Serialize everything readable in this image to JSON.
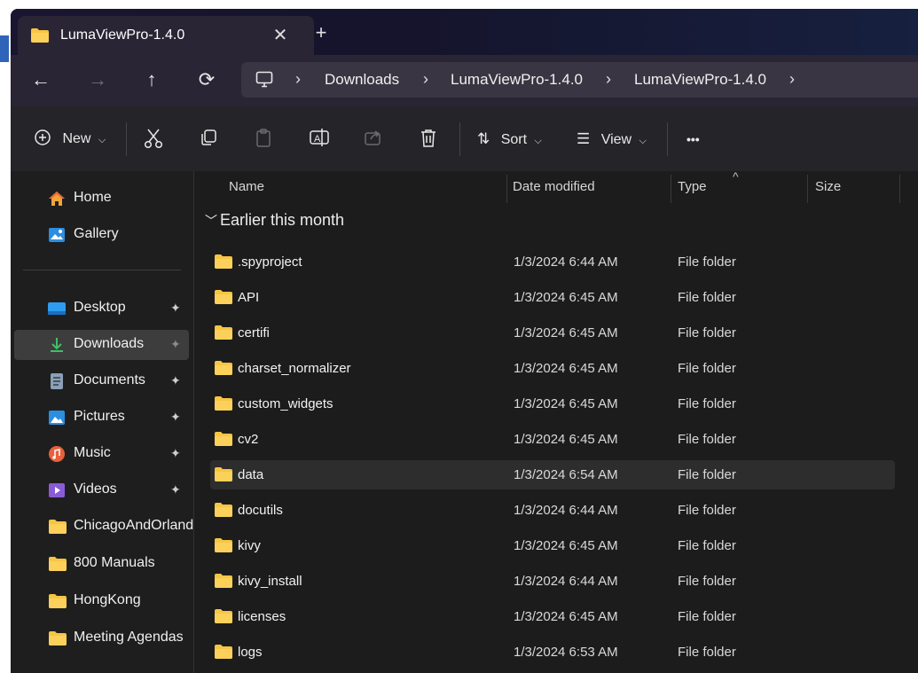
{
  "tab": {
    "title": "LumaViewPro-1.4.0",
    "close": "✕",
    "new_tab": "+"
  },
  "nav": {
    "back": "←",
    "forward": "→",
    "up": "↑",
    "refresh": "⟳"
  },
  "breadcrumb": {
    "items": [
      "Downloads",
      "LumaViewPro-1.4.0",
      "LumaViewPro-1.4.0"
    ],
    "separator": "›"
  },
  "toolbar": {
    "new_label": "New",
    "sort_label": "Sort",
    "view_label": "View",
    "more": "•••"
  },
  "sidebar": {
    "top": [
      {
        "label": "Home",
        "icon": "home-icon"
      },
      {
        "label": "Gallery",
        "icon": "gallery-icon"
      }
    ],
    "pinned": [
      {
        "label": "Desktop",
        "icon": "desktop-icon"
      },
      {
        "label": "Downloads",
        "icon": "downloads-icon"
      },
      {
        "label": "Documents",
        "icon": "documents-icon"
      },
      {
        "label": "Pictures",
        "icon": "pictures-icon"
      },
      {
        "label": "Music",
        "icon": "music-icon"
      },
      {
        "label": "Videos",
        "icon": "videos-icon"
      }
    ],
    "folders": [
      {
        "label": "ChicagoAndOrland",
        "icon": "folder-icon"
      },
      {
        "label": "800 Manuals",
        "icon": "folder-icon"
      },
      {
        "label": "HongKong",
        "icon": "folder-icon"
      },
      {
        "label": "Meeting Agendas",
        "icon": "folder-icon"
      }
    ],
    "pin_glyph": "📌",
    "selected": "Downloads"
  },
  "columns": {
    "name": "Name",
    "date": "Date modified",
    "type": "Type",
    "size": "Size",
    "sort_indicator": "^"
  },
  "group": {
    "label": "Earlier this month"
  },
  "files": [
    {
      "name": ".spyproject",
      "date": "1/3/2024 6:44 AM",
      "type": "File folder"
    },
    {
      "name": "API",
      "date": "1/3/2024 6:45 AM",
      "type": "File folder"
    },
    {
      "name": "certifi",
      "date": "1/3/2024 6:45 AM",
      "type": "File folder"
    },
    {
      "name": "charset_normalizer",
      "date": "1/3/2024 6:45 AM",
      "type": "File folder"
    },
    {
      "name": "custom_widgets",
      "date": "1/3/2024 6:45 AM",
      "type": "File folder"
    },
    {
      "name": "cv2",
      "date": "1/3/2024 6:45 AM",
      "type": "File folder"
    },
    {
      "name": "data",
      "date": "1/3/2024 6:54 AM",
      "type": "File folder"
    },
    {
      "name": "docutils",
      "date": "1/3/2024 6:44 AM",
      "type": "File folder"
    },
    {
      "name": "kivy",
      "date": "1/3/2024 6:45 AM",
      "type": "File folder"
    },
    {
      "name": "kivy_install",
      "date": "1/3/2024 6:44 AM",
      "type": "File folder"
    },
    {
      "name": "licenses",
      "date": "1/3/2024 6:45 AM",
      "type": "File folder"
    },
    {
      "name": "logs",
      "date": "1/3/2024 6:53 AM",
      "type": "File folder"
    }
  ],
  "hovered_row": "data",
  "colors": {
    "folder": "#f7c544",
    "accent": "#4cc2ff",
    "selected_bg": "#3d3d3d"
  }
}
